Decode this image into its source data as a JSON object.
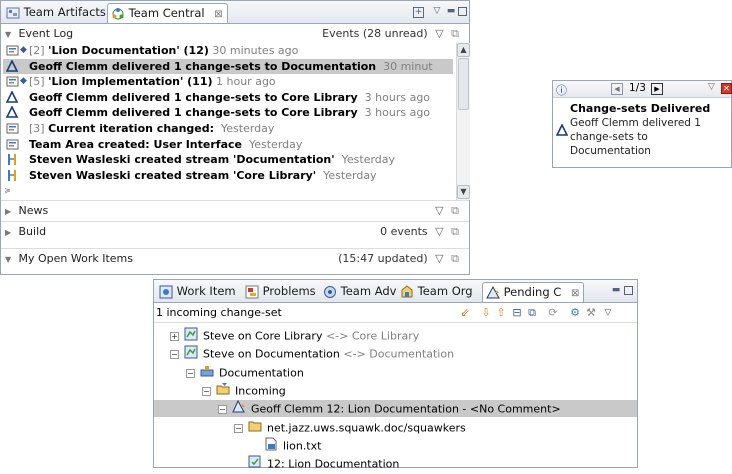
{
  "top_view": {
    "tabs": [
      {
        "label": "Team Artifacts",
        "icon": "team-artifacts-icon"
      },
      {
        "label": "Team Central",
        "icon": "team-central-icon"
      }
    ],
    "sections": {
      "event_log": {
        "label": "Event Log",
        "status": "Events (28 unread)"
      },
      "news": {
        "label": "News"
      },
      "build": {
        "label": "Build",
        "status": "0 events"
      },
      "my_work_items": {
        "label": "My Open Work Items",
        "status": "(15:47 updated)"
      }
    },
    "events": [
      {
        "prefix": "[2] ",
        "bold": "'Lion Documentation' (12)",
        "time": " 30 minutes ago",
        "icon": "feed-group-icon",
        "diamond": true,
        "selected": false
      },
      {
        "prefix": "",
        "bold": "Geoff Clemm delivered 1 change-sets to Documentation",
        "time": "  30 minut",
        "icon": "delta-icon",
        "diamond": false,
        "selected": true
      },
      {
        "prefix": "[5] ",
        "bold": "'Lion Implementation' (11)",
        "time": " 1 hour ago",
        "icon": "feed-group-icon",
        "diamond": true,
        "selected": false
      },
      {
        "prefix": "",
        "bold": "Geoff Clemm delivered 1 change-sets to Core Library",
        "time": "  3 hours ago",
        "icon": "delta-icon",
        "diamond": false,
        "selected": false
      },
      {
        "prefix": "",
        "bold": "Geoff Clemm delivered 1 change-sets to Core Library",
        "time": "  3 hours ago",
        "icon": "delta-icon",
        "diamond": false,
        "selected": false
      },
      {
        "prefix": "[3] ",
        "bold": "Current iteration changed:",
        "time": "  Yesterday",
        "icon": "feed-icon",
        "diamond": false,
        "selected": false
      },
      {
        "prefix": "",
        "bold": "Team Area created: User Interface",
        "time": "  Yesterday",
        "icon": "feed-icon",
        "diamond": false,
        "selected": false
      },
      {
        "prefix": "",
        "bold": "Steven Wasleski created stream 'Documentation'",
        "time": "  Yesterday",
        "icon": "stream-icon",
        "diamond": false,
        "selected": false
      },
      {
        "prefix": "",
        "bold": "Steven Wasleski created stream 'Core Library'",
        "time": "  Yesterday",
        "icon": "stream-icon",
        "diamond": false,
        "selected": false
      }
    ]
  },
  "popup": {
    "pager": "1/3",
    "title": "Change-sets Delivered",
    "body_lines": [
      "Geoff Clemm delivered 1",
      "change-sets to",
      "Documentation"
    ]
  },
  "bottom_view": {
    "tabs": [
      {
        "label": "Work Item",
        "icon": "work-item-icon"
      },
      {
        "label": "Problems",
        "icon": "problems-icon"
      },
      {
        "label": "Team Adv",
        "icon": "team-advisor-icon"
      },
      {
        "label": "Team Org",
        "icon": "team-org-icon"
      },
      {
        "label": "Pending C",
        "icon": "pending-changes-icon"
      }
    ],
    "summary": "1 incoming change-set",
    "tree": [
      {
        "level": 0,
        "expander": "+",
        "icon": "workspace-icon",
        "text": "Steve on Core Library",
        "suffix": " <-> Core Library",
        "selected": false
      },
      {
        "level": 0,
        "expander": "−",
        "icon": "workspace-icon",
        "text": "Steve on Documentation",
        "suffix": " <-> Documentation",
        "selected": false
      },
      {
        "level": 1,
        "expander": "−",
        "icon": "component-icon",
        "text": "Documentation",
        "suffix": "",
        "selected": false
      },
      {
        "level": 2,
        "expander": "−",
        "icon": "incoming-folder-icon",
        "text": "Incoming",
        "suffix": "",
        "selected": false
      },
      {
        "level": 3,
        "expander": "−",
        "icon": "change-set-icon",
        "text": "Geoff Clemm  12: Lion Documentation - <No Comment>",
        "suffix": "",
        "selected": true
      },
      {
        "level": 4,
        "expander": "−",
        "icon": "folder-icon",
        "text": "net.jazz.uws.squawk.doc/squawkers",
        "suffix": "",
        "selected": false
      },
      {
        "level": 5,
        "expander": "",
        "icon": "file-icon",
        "text": "lion.txt",
        "suffix": "",
        "selected": false
      },
      {
        "level": 4,
        "expander": "",
        "icon": "work-item-link-icon",
        "text": "12: Lion Documentation",
        "suffix": "",
        "selected": false
      }
    ]
  }
}
